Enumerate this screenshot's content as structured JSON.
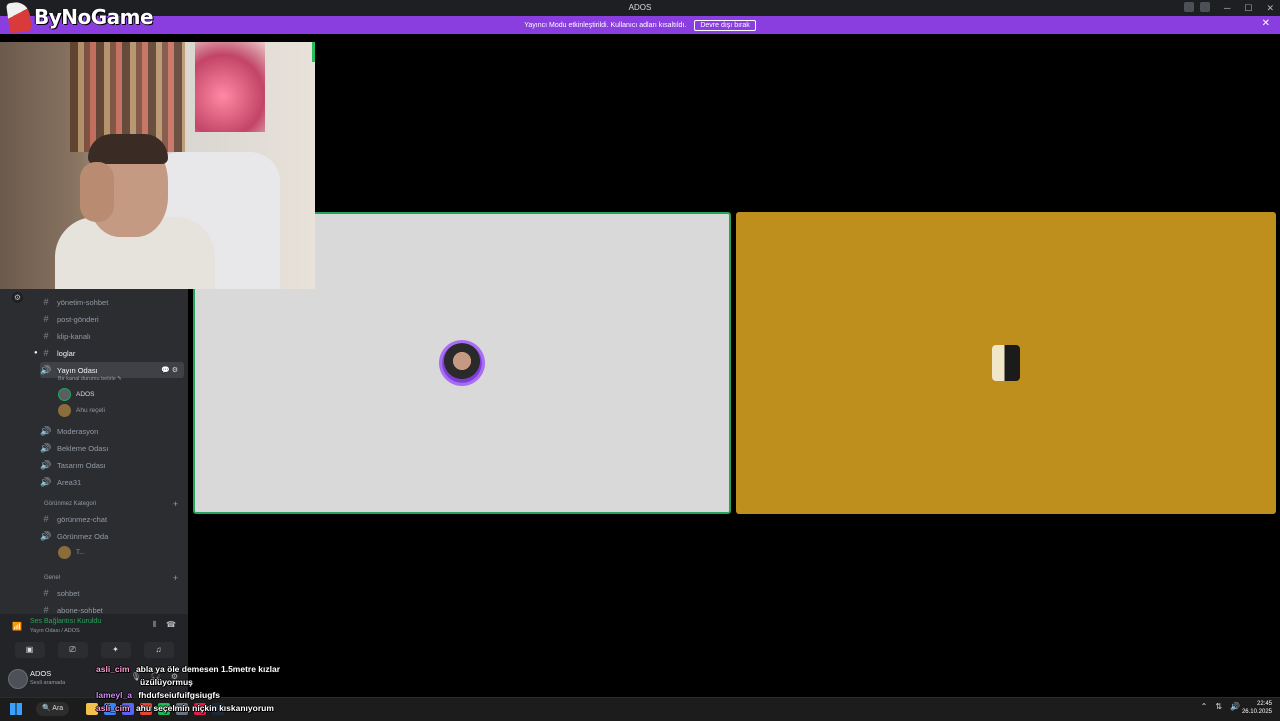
{
  "window": {
    "title": "ADOS",
    "controls": [
      "─",
      "☐",
      "✕"
    ]
  },
  "banner": {
    "message": "Yayıncı Modu etkinleştirildi. Kullanıcı adları kısaltıldı.",
    "button": "Devre dışı bırak",
    "close": "✕"
  },
  "logo": {
    "text": "ByNoGame"
  },
  "channels": [
    {
      "name": "yönetim-sohbet",
      "icon": "#"
    },
    {
      "name": "post-gönderi",
      "icon": "#"
    },
    {
      "name": "klip-kanalı",
      "icon": "#"
    },
    {
      "name": "loglar",
      "icon": "#"
    },
    {
      "name": "Yayın Odası",
      "icon": "🔊",
      "status": "Bir kanal durumu belirle ✎"
    },
    {
      "name": "Moderasyon",
      "icon": "🔊"
    },
    {
      "name": "Bekleme Odası",
      "icon": "🔊"
    },
    {
      "name": "Tasarım Odası",
      "icon": "🔊"
    },
    {
      "name": "Area31",
      "icon": "🔊"
    },
    {
      "name": "görünmez-chat",
      "icon": "#"
    },
    {
      "name": "Görünmez Oda",
      "icon": "🔊"
    },
    {
      "name": "sohbet",
      "icon": "#"
    },
    {
      "name": "abone-sohbet",
      "icon": "#"
    }
  ],
  "categories": {
    "invisible": "Görünmez Kategori",
    "general": "Genel"
  },
  "voice_users": [
    {
      "name": "ADOS"
    },
    {
      "name": "Ahu reçeli"
    },
    {
      "name": "T..."
    }
  ],
  "voice_panel": {
    "status": "Ses Bağlantısı Kuruldu",
    "location": "Yayın Odası / ADOS"
  },
  "user_panel": {
    "name": "ADOS",
    "status": "Sesli aramada"
  },
  "chat": [
    {
      "user": "asli_cim",
      "message": "abla ya öle demesen 1.5metre kızlar"
    },
    {
      "user": "",
      "message": "üzülüyormuş"
    },
    {
      "user": "lameyl_a",
      "message": "fhdufseiufuifgsiugfs"
    },
    {
      "user": "asli_cim",
      "message": "ahu seçelmin niçkin kıskanıyorum"
    }
  ],
  "taskbar": {
    "search": "Ara",
    "time": "22:45",
    "date": "26.10.2025"
  },
  "colors": {
    "banner": "#8a3ee0",
    "speaking": "#23a559",
    "tile_gold": "#bf8f1e",
    "tile_grey": "#d9d9d9"
  }
}
